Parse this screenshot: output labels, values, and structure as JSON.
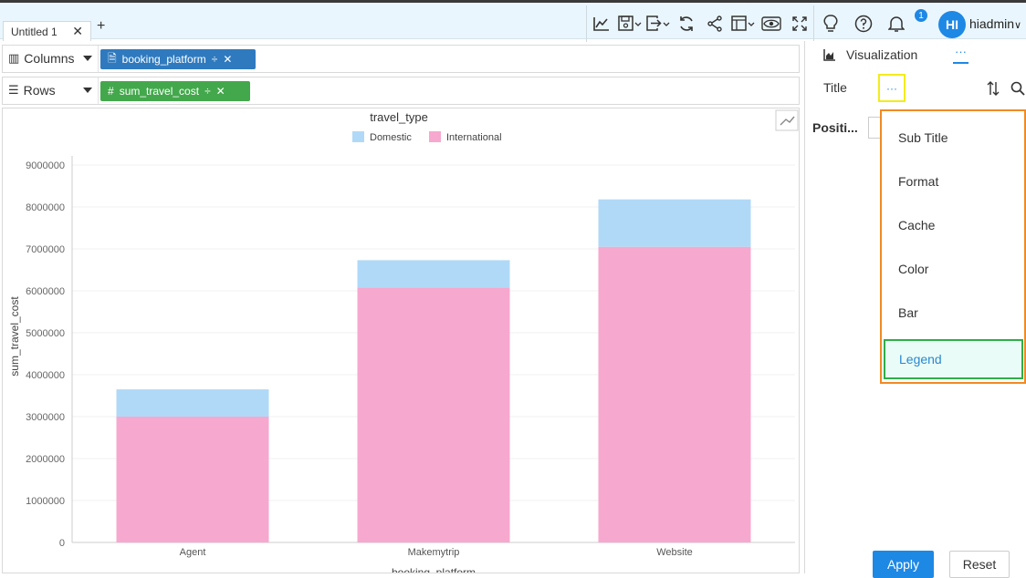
{
  "tabs": [
    {
      "label": "Untitled 1"
    }
  ],
  "user": {
    "initials": "HI",
    "name": "hiadmin",
    "notifications": "1"
  },
  "shelves": {
    "columns": {
      "label": "Columns",
      "field": "booking_platform"
    },
    "rows": {
      "label": "Rows",
      "field": "sum_travel_cost"
    }
  },
  "panel": {
    "tab_label": "Visualization",
    "more_label": "···",
    "section_label": "Title",
    "position_label": "Positi...",
    "menu_items": [
      "Sub Title",
      "Format",
      "Cache",
      "Color",
      "Bar",
      "Legend"
    ],
    "apply_label": "Apply",
    "reset_label": "Reset"
  },
  "colors": {
    "domestic": "#b0d9f7",
    "international": "#f7a8ce",
    "accent": "#1e88e5"
  },
  "chart_data": {
    "type": "bar",
    "stacked": true,
    "title": "travel_type",
    "categories": [
      "Agent",
      "Makemytrip",
      "Website"
    ],
    "series": [
      {
        "name": "International",
        "values": [
          3000000,
          6080000,
          7050000
        ]
      },
      {
        "name": "Domestic",
        "values": [
          650000,
          650000,
          1130000
        ]
      }
    ],
    "xlabel": "booking_platform",
    "ylabel": "sum_travel_cost",
    "ylim": [
      0,
      9000000
    ],
    "yticks": [
      "0",
      "1000000",
      "2000000",
      "3000000",
      "4000000",
      "5000000",
      "6000000",
      "7000000",
      "8000000",
      "9000000"
    ],
    "legend": [
      "Domestic",
      "International"
    ],
    "legend_position": "top",
    "grid": true
  }
}
